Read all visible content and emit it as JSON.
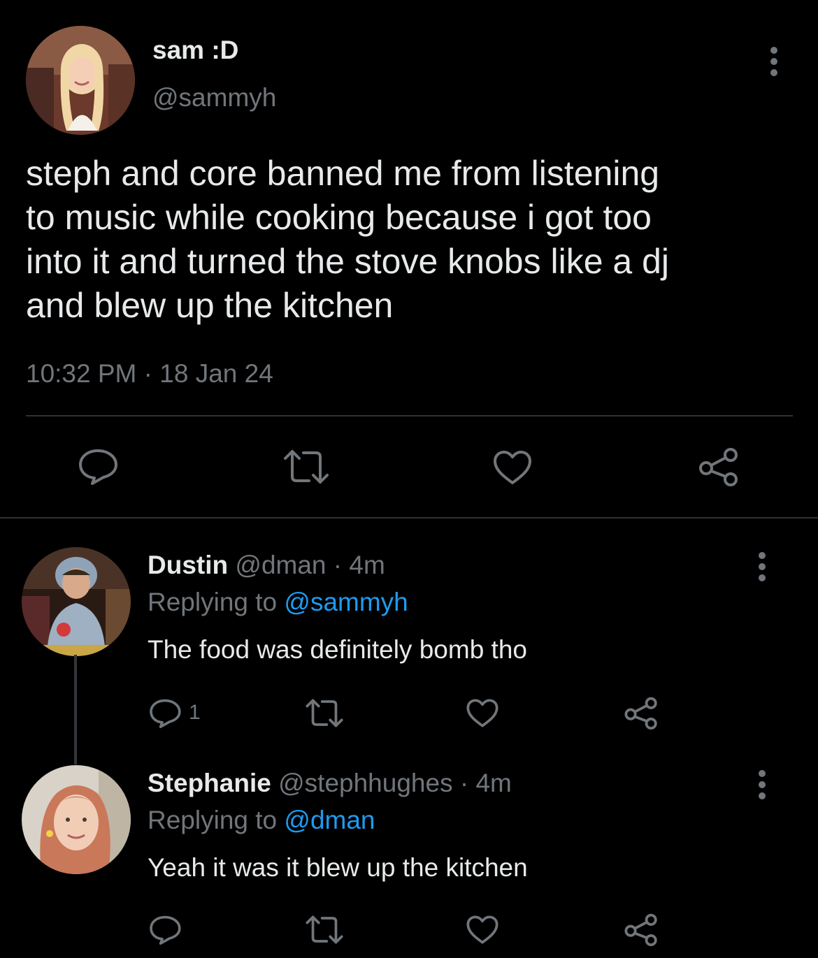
{
  "main_tweet": {
    "display_name": "sam :D",
    "handle": "@sammyh",
    "text_lines": [
      "steph and core banned me from listening",
      "to music while cooking because i got too",
      "into it and turned the stove knobs like a dj",
      "and blew up the kitchen"
    ],
    "time": "10:32 PM",
    "separator": "·",
    "date": "18 Jan 24",
    "actions": [
      "reply-icon",
      "retweet-icon",
      "like-icon",
      "share-icon"
    ]
  },
  "replies": [
    {
      "display_name": "Dustin",
      "handle": "@dman",
      "separator": "·",
      "age": "4m",
      "replying_prefix": "Replying to",
      "replying_to": "@sammyh",
      "text": "The food was definitely bomb tho",
      "reply_count": "1"
    },
    {
      "display_name": "Stephanie",
      "handle": "@stephhughes",
      "separator": "·",
      "age": "4m",
      "replying_prefix": "Replying to",
      "replying_to": "@dman",
      "text": "Yeah it was it blew up the kitchen",
      "reply_count": ""
    }
  ],
  "colors": {
    "background": "#000000",
    "primary_text": "#e7e9ea",
    "secondary_text": "#71767b",
    "link": "#1d9bf0",
    "divider": "#2f3336"
  }
}
